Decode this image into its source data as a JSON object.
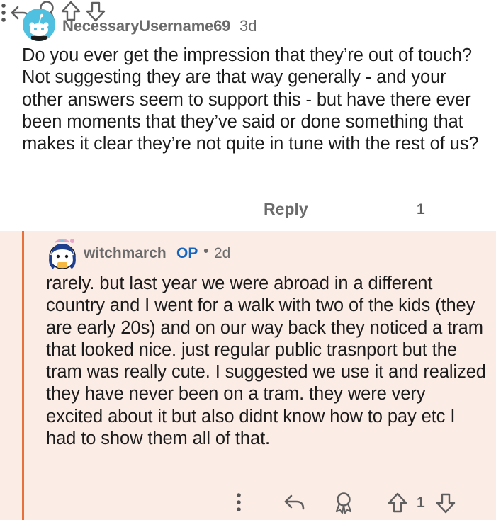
{
  "parent_comment": {
    "username": "NecessaryUsername69",
    "time": "3d",
    "body": "Do you ever get the impression that they’re out of touch? Not suggesting they are that way generally - and your other answers seem to support this - but have there ever been moments that they’ve said or done something that makes it clear they’re not quite in tune with the rest of us?",
    "actions": {
      "reply_label": "Reply",
      "vote_count": "1"
    }
  },
  "reply_comment": {
    "username": "witchmarch",
    "badge": "OP",
    "separator": "•",
    "time": "2d",
    "body": "rarely. but last year we were abroad in a different country and I went for a walk with two of the kids (they are early 20s) and on our way back they noticed a tram that looked nice. just regular public trasnport but the tram was really cute. I suggested we use it and realized they have never been on a tram. they were very excited about it but also didnt know how to pay etc I had to show them all of that.",
    "actions": {
      "vote_count": "1"
    }
  },
  "colors": {
    "thread_line": "#e8703c",
    "reply_background": "#fcece6",
    "op_badge": "#1565c0",
    "meta_text": "#6b6b6b"
  },
  "icons": [
    "more-options-icon",
    "reply-arrow-icon",
    "award-icon",
    "upvote-icon",
    "downvote-icon",
    "snoo-avatar-icon"
  ]
}
